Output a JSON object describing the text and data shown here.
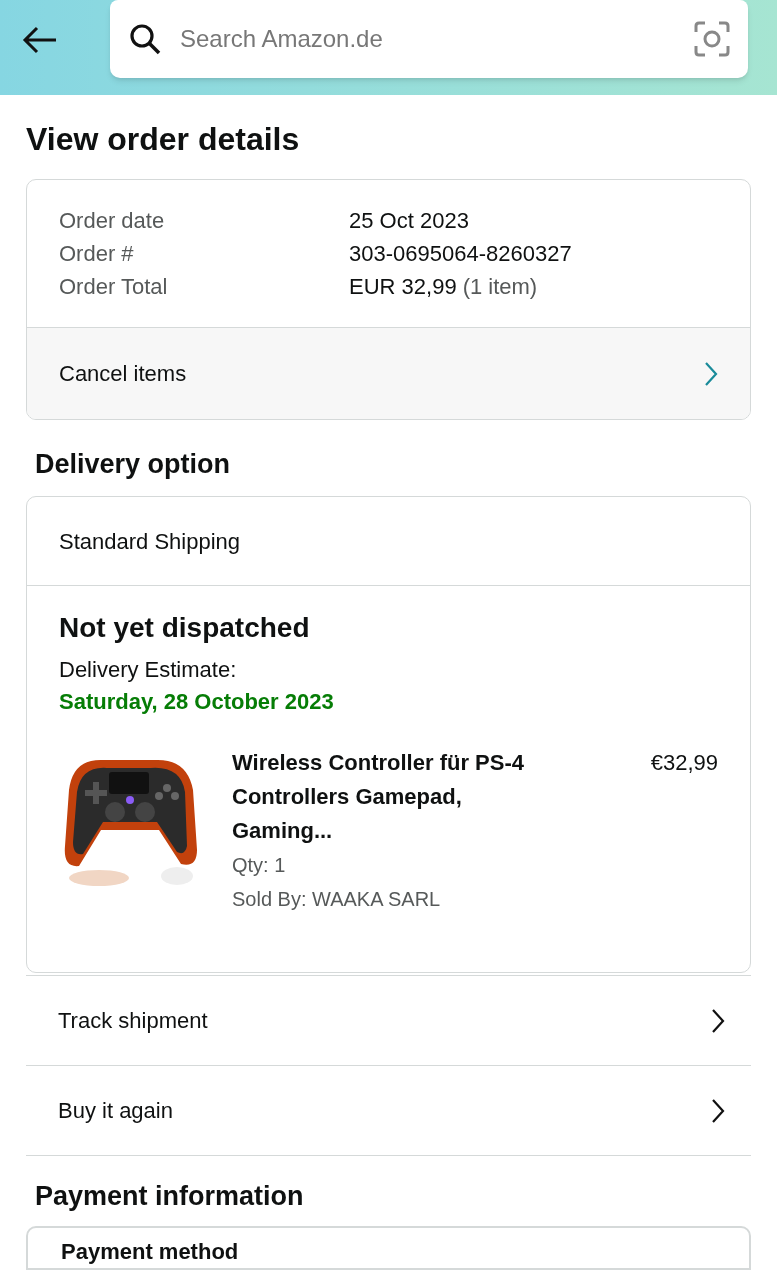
{
  "search": {
    "placeholder": "Search Amazon.de"
  },
  "title": "View order details",
  "order_summary": [
    {
      "label": "Order date",
      "value": "25 Oct 2023"
    },
    {
      "label": "Order #",
      "value": "303-0695064-8260327"
    },
    {
      "label": "Order Total",
      "value": "EUR 32,99",
      "note": "(1 item)"
    }
  ],
  "cancel_link": "Cancel items",
  "delivery": {
    "heading": "Delivery option",
    "method": "Standard Shipping",
    "status": "Not yet dispatched",
    "estimate_label": "Delivery Estimate:",
    "estimate_date": "Saturday, 28 October 2023",
    "item": {
      "kind": "picture",
      "title": "Wireless Controller für PS-4 Controllers Gamepad, Gaming...",
      "price": "€32,99",
      "qty": "Qty: 1",
      "seller": "Sold By: WAAKA SARL"
    }
  },
  "actions": [
    "Track shipment",
    "Buy it again"
  ],
  "payment": {
    "heading": "Payment information",
    "method_label": "Payment method"
  }
}
